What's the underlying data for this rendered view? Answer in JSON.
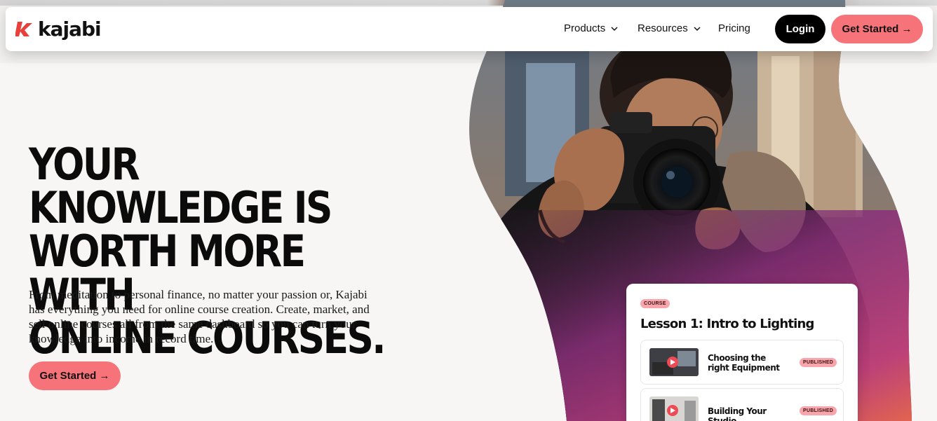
{
  "brand": {
    "name": "kajabi",
    "accent": "#f7737a",
    "mark_color": "#e8413c"
  },
  "nav": {
    "items": [
      {
        "label": "Products",
        "has_dropdown": true
      },
      {
        "label": "Resources",
        "has_dropdown": true
      },
      {
        "label": "Pricing",
        "has_dropdown": false
      }
    ],
    "login_label": "Login",
    "cta_label": "Get Started →"
  },
  "hero": {
    "headline": "YOUR KNOWLEDGE IS\nWORTH MORE WITH\nONLINE COURSES.",
    "subtext": "From meditation to personal finance, no matter your passion or, Kajabi has everything you need for online course creation. Create, market, and sell online courses all from the same dashboard so you can turn your knowledge into income in record time.",
    "cta_label": "Get Started →"
  },
  "course_card": {
    "badge": "COURSE",
    "title": "Lesson 1: Intro to Lighting",
    "lessons": [
      {
        "title": "Choosing the\nright Equipment",
        "status": "PUBLISHED"
      },
      {
        "title": "Building Your Studio",
        "status": "PUBLISHED"
      }
    ]
  }
}
